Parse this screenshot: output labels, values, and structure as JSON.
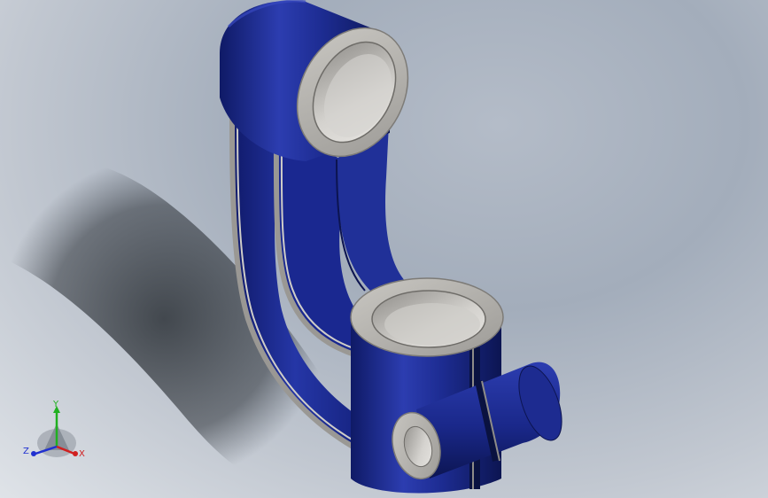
{
  "colors": {
    "part_body": "#1b2a8c",
    "part_highlight": "#3a4cc4",
    "part_shadow": "#0d1650",
    "machined_face": "#b7b5b0",
    "background_top": "#a3adbb",
    "background_bottom": "#dfe3e8",
    "axis_x": "#d02020",
    "axis_y": "#20b020",
    "axis_z": "#2030d0"
  },
  "triad": {
    "x_label": "X",
    "y_label": "Y",
    "z_label": "Z"
  },
  "icons": {
    "triad": "reference-triad-icon"
  }
}
